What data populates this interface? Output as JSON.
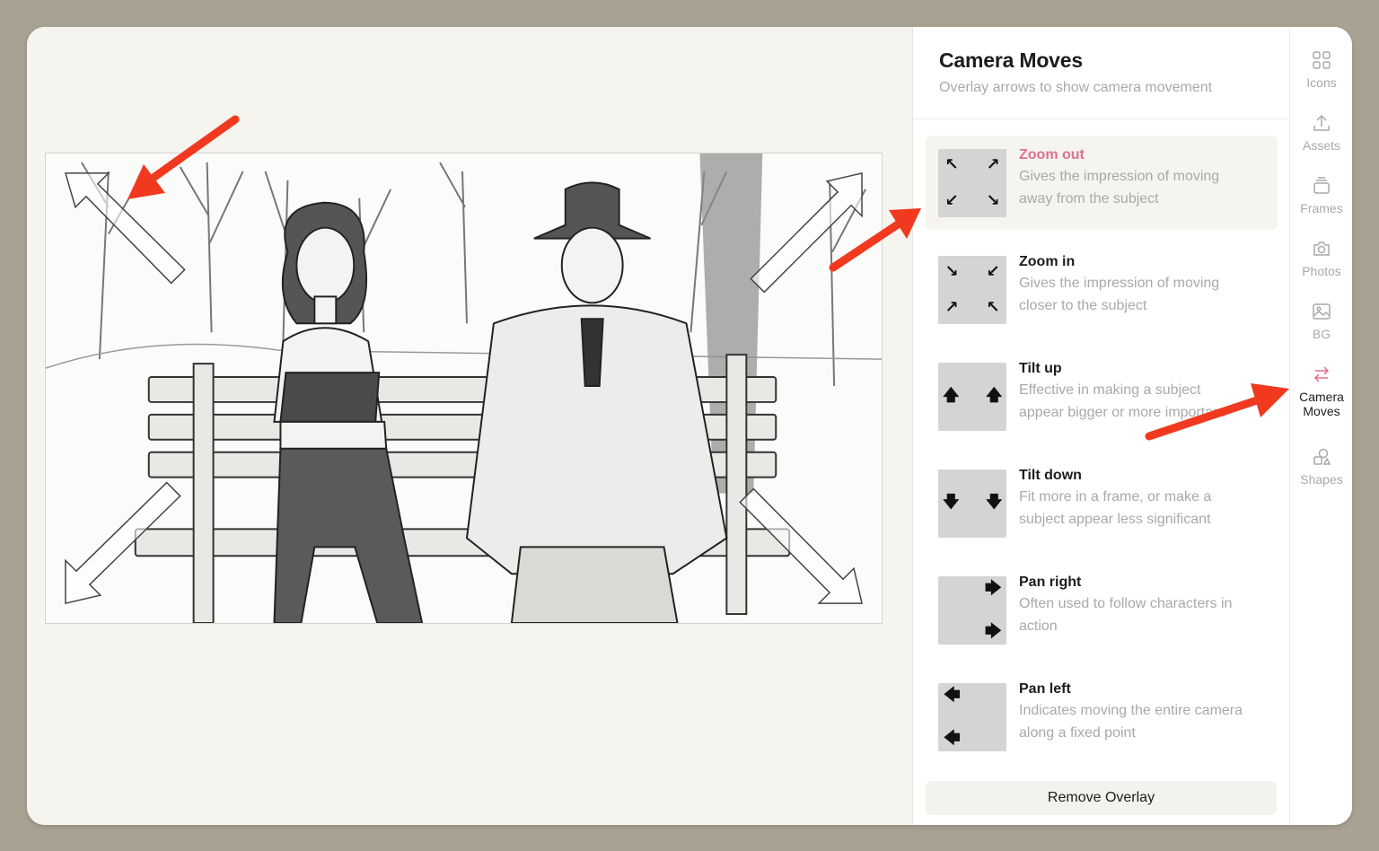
{
  "panel": {
    "title": "Camera Moves",
    "subtitle": "Overlay arrows to show camera movement",
    "selected_index": 0,
    "moves": [
      {
        "name": "Zoom out",
        "desc_line1": "Gives the impression of moving",
        "desc_line2": "away from the subject"
      },
      {
        "name": "Zoom in",
        "desc_line1": "Gives the impression of moving",
        "desc_line2": "closer to the subject"
      },
      {
        "name": "Tilt up",
        "desc_line1": "Effective in making a subject",
        "desc_line2": "appear bigger or more important"
      },
      {
        "name": "Tilt down",
        "desc_line1": "Fit more in a frame, or make a",
        "desc_line2": "subject appear less significant"
      },
      {
        "name": "Pan right",
        "desc_line1": "Often used to follow characters in",
        "desc_line2": "action"
      },
      {
        "name": "Pan left",
        "desc_line1": "Indicates moving the entire camera",
        "desc_line2": "along a fixed point"
      }
    ],
    "remove_label": "Remove Overlay"
  },
  "rail": {
    "items": [
      {
        "label": "Icons",
        "icon": "grid-icon"
      },
      {
        "label": "Assets",
        "icon": "upload-icon"
      },
      {
        "label": "Frames",
        "icon": "frames-icon"
      },
      {
        "label": "Photos",
        "icon": "camera-icon"
      },
      {
        "label": "BG",
        "icon": "image-icon"
      },
      {
        "label_line1": "Camera",
        "label_line2": "Moves",
        "icon": "swap-arrows-icon",
        "active": true
      },
      {
        "label": "Shapes",
        "icon": "shapes-icon"
      }
    ]
  },
  "colors": {
    "accent": "#e0708d",
    "annotation": "#f0391f",
    "thumb": "#d4d4d4",
    "muted_text": "#a9a9a9"
  }
}
